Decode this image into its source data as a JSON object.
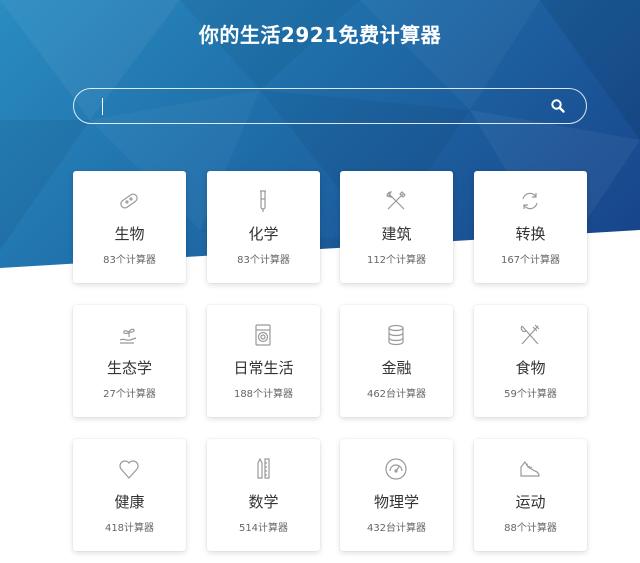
{
  "header": {
    "title": "你的生活2921免费计算器"
  },
  "search": {
    "placeholder": "",
    "value": ""
  },
  "categories": [
    {
      "name": "生物",
      "count": "83个计算器",
      "icon": "bacteria-icon"
    },
    {
      "name": "化学",
      "count": "83个计算器",
      "icon": "test-tube-icon"
    },
    {
      "name": "建筑",
      "count": "112个计算器",
      "icon": "wrench-screwdriver-icon"
    },
    {
      "name": "转换",
      "count": "167个计算器",
      "icon": "refresh-icon"
    },
    {
      "name": "生态学",
      "count": "27个计算器",
      "icon": "seedling-hand-icon"
    },
    {
      "name": "日常生活",
      "count": "188个计算器",
      "icon": "washing-machine-icon"
    },
    {
      "name": "金融",
      "count": "462台计算器",
      "icon": "coin-stack-icon"
    },
    {
      "name": "食物",
      "count": "59个计算器",
      "icon": "fork-knife-icon"
    },
    {
      "name": "健康",
      "count": "418计算器",
      "icon": "heart-icon"
    },
    {
      "name": "数学",
      "count": "514计算器",
      "icon": "pencil-ruler-icon"
    },
    {
      "name": "物理学",
      "count": "432台计算器",
      "icon": "gauge-icon"
    },
    {
      "name": "运动",
      "count": "88个计算器",
      "icon": "running-shoe-icon"
    }
  ]
}
